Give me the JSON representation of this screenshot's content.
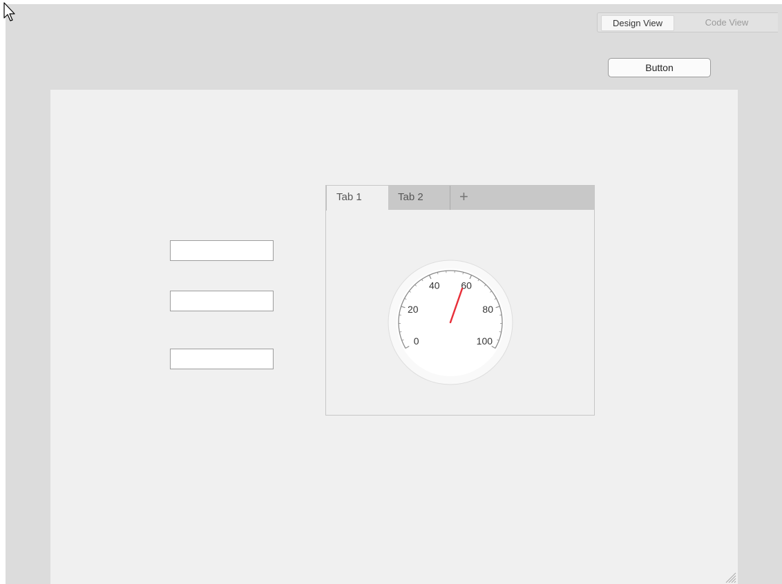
{
  "header": {
    "view_toggle": {
      "design_label": "Design View",
      "code_label": "Code View",
      "active": "Design View"
    },
    "button_label": "Button"
  },
  "canvas": {
    "edit_fields": [
      {
        "value": ""
      },
      {
        "value": ""
      },
      {
        "value": ""
      }
    ],
    "tab_group": {
      "tabs": [
        {
          "label": "Tab 1",
          "selected": true
        },
        {
          "label": "Tab 2",
          "selected": false
        }
      ],
      "add_tab_icon": "plus-icon"
    },
    "gauge": {
      "min": 0,
      "max": 100,
      "value": 58,
      "tick_labels": [
        "0",
        "20",
        "40",
        "60",
        "80",
        "100"
      ],
      "needle_color": "#e8303a",
      "scale_color": "#8a8a8a"
    }
  },
  "icons": {
    "cursor": "mouse-pointer-icon",
    "resize": "resize-grip-icon"
  }
}
